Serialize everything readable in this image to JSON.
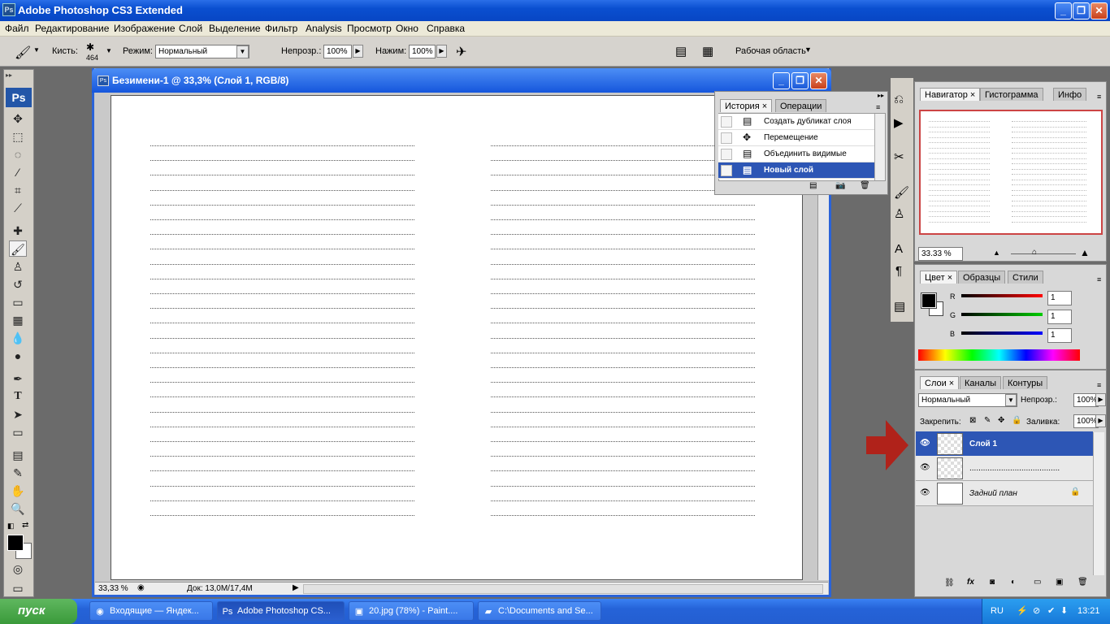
{
  "app": {
    "title": "Adobe Photoshop CS3 Extended"
  },
  "menu": [
    "Файл",
    "Редактирование",
    "Изображение",
    "Слой",
    "Выделение",
    "Фильтр",
    "Analysis",
    "Просмотр",
    "Окно",
    "Справка"
  ],
  "options": {
    "brush_label": "Кисть:",
    "brush_size": "464",
    "mode_label": "Режим:",
    "mode_value": "Нормальный",
    "opacity_label": "Непрозр.:",
    "opacity_value": "100%",
    "flow_label": "Нажим:",
    "flow_value": "100%",
    "workspace_label": "Рабочая область"
  },
  "document": {
    "title": "Безимени-1 @ 33,3% (Слой 1, RGB/8)",
    "zoom": "33,33 %",
    "doc_info": "Док: 13,0M/17,4M"
  },
  "history": {
    "tabs": [
      "История",
      "Операции"
    ],
    "items": [
      "Создать дубликат слоя",
      "Перемещение",
      "Объединить видимые",
      "Новый слой"
    ]
  },
  "navigator": {
    "tabs": [
      "Навигатор",
      "Гистограмма",
      "Инфо"
    ],
    "zoom": "33.33 %"
  },
  "color": {
    "tabs": [
      "Цвет",
      "Образцы",
      "Стили"
    ],
    "r_label": "R",
    "g_label": "G",
    "b_label": "B",
    "r": "1",
    "g": "1",
    "b": "1"
  },
  "layers": {
    "tabs": [
      "Слои",
      "Каналы",
      "Контуры"
    ],
    "blend_mode": "Нормальный",
    "opacity_label": "Непрозр.:",
    "opacity": "100%",
    "lock_label": "Закрепить:",
    "fill_label": "Заливка:",
    "fill": "100%",
    "items": [
      {
        "name": "Слой 1",
        "selected": true
      },
      {
        "name": "........................................",
        "selected": false
      },
      {
        "name": "Задний план",
        "selected": false
      }
    ]
  },
  "taskbar": {
    "start": "пуск",
    "tasks": [
      "Входящие — Яндек...",
      "Adobe Photoshop CS...",
      "20.jpg (78%) - Paint....",
      "C:\\Documents and Se..."
    ],
    "lang": "RU",
    "time": "13:21"
  },
  "colors": {
    "accent": "#2d56b5",
    "titlebar": "#0a4fd0",
    "arrow": "#b0221a"
  }
}
